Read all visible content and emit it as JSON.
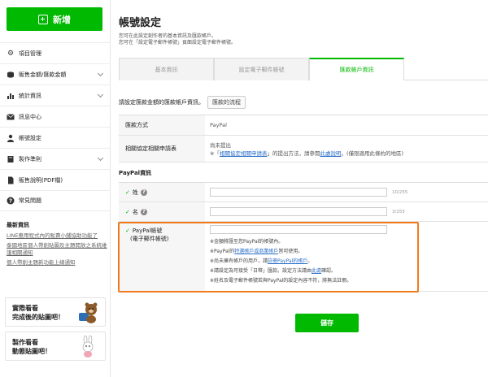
{
  "sidebar": {
    "new_label": "新增",
    "items": [
      {
        "label": "項目管理",
        "icon": "gear-icon",
        "chevron": false
      },
      {
        "label": "販售金額/匯款金額",
        "icon": "coins-icon",
        "chevron": true
      },
      {
        "label": "統計資訊",
        "icon": "chart-icon",
        "chevron": true
      },
      {
        "label": "訊息中心",
        "icon": "mail-icon",
        "chevron": false
      },
      {
        "label": "帳號設定",
        "icon": "user-icon",
        "chevron": false
      },
      {
        "label": "製作準則",
        "icon": "book-icon",
        "chevron": true
      },
      {
        "label": "販售說明(PDF檔)",
        "icon": "document-icon",
        "chevron": false
      },
      {
        "label": "常見問題",
        "icon": "help-icon",
        "chevron": false
      }
    ],
    "news": {
      "title": "最新資訊",
      "links": [
        "LINE應用程式內的販賣小舖協助功能了",
        "泰國地區個人帶創貼圖及主題開放之系統維護相關通知",
        "個人帶創主題新功能上線通知"
      ]
    },
    "promos": [
      {
        "line1": "實際看看",
        "line2": "完成後的貼圖吧！"
      },
      {
        "line1": "製作看看",
        "line2": "動態貼圖吧！"
      }
    ]
  },
  "page": {
    "title": "帳號設定",
    "desc1": "您可在此設定創作者的基本資訊及匯款帳戶。",
    "desc2": "您可在「設定電子郵件帳號」頁面設定電子郵件帳號。"
  },
  "tabs": [
    {
      "label": "基本資訊",
      "active": false
    },
    {
      "label": "設定電子郵件帳號",
      "active": false
    },
    {
      "label": "匯款帳戶資訊",
      "active": true
    }
  ],
  "intro": {
    "text": "請設定匯款金額的匯款帳戶資訊。",
    "flow_button": "匯款的流程"
  },
  "payment": {
    "method_label": "匯款方式",
    "method_value": "PayPal",
    "agreement_label": "相關協定相關申請表",
    "agreement_status": "尚未提出",
    "agreement_note_pre": "※「",
    "agreement_link": "相關協定相關申請表",
    "agreement_note_mid": "」的提出方法，請參閱",
    "agreement_link2": "此處說明",
    "agreement_note_post": "。(僅限適用此條約的地區)"
  },
  "paypal": {
    "section_title": "PayPal資訊",
    "last_name_label": "姓",
    "last_name_counter": "10/255",
    "first_name_label": "名",
    "first_name_counter": "3/255",
    "account_label": "PayPal帳號",
    "account_sublabel": "(電子郵件帳號)",
    "notes": {
      "n1": "※金額將匯至您PayPal的帳號內。",
      "n2_pre": "※PayPal的",
      "n2_link": "特選帳戶或商業帳戶",
      "n2_post": "皆可使用。",
      "n3_pre": "※尚未擁有帳戶的用戶，請",
      "n3_link": "註冊PayPal的帳戶",
      "n3_post": "。",
      "n4_pre": "※請設定為可接受「日幣」匯款。設定方法請由",
      "n4_link": "此處",
      "n4_post": "確認。",
      "n5": "※姓名及電子郵件帳號若與PayPal的設定內容不符，將無法註冊。"
    }
  },
  "save_label": "儲存",
  "colors": {
    "accent": "#00b900",
    "highlight": "#f07b1f",
    "link": "#2a6fc9"
  }
}
